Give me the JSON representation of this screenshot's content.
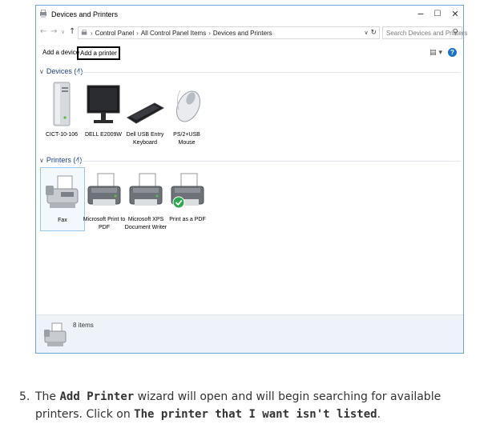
{
  "window": {
    "title": "Devices and Printers",
    "minimize": "−",
    "maximize": "☐",
    "close": "✕"
  },
  "address": {
    "crumbs": [
      "Control Panel",
      "All Control Panel Items",
      "Devices and Printers"
    ],
    "separator": "›",
    "dropdown": "∨",
    "refresh": "↻",
    "search_placeholder": "Search Devices and Printers",
    "search_icon": "search-icon"
  },
  "nav": {
    "back": "←",
    "forward": "→",
    "recent": "∨",
    "up": "↑"
  },
  "commands": {
    "add_device": "Add a device",
    "add_printer": "Add a printer",
    "view": "▤ ▾",
    "help": "?"
  },
  "devices": {
    "header": "Devices (4)",
    "items": [
      {
        "label_lines": [
          "CICT-10-106"
        ],
        "icon": "computer-tower-icon"
      },
      {
        "label_lines": [
          "DELL E2009W"
        ],
        "icon": "monitor-icon"
      },
      {
        "label_lines": [
          "Dell USB Entry",
          "Keyboard"
        ],
        "icon": "keyboard-icon"
      },
      {
        "label_lines": [
          "PS/2+USB Mouse"
        ],
        "icon": "mouse-icon"
      }
    ]
  },
  "printers": {
    "header": "Printers (4)",
    "items": [
      {
        "label_lines": [
          "Fax"
        ],
        "icon": "fax-icon",
        "selected": true
      },
      {
        "label_lines": [
          "Microsoft Print to",
          "PDF"
        ],
        "icon": "printer-icon"
      },
      {
        "label_lines": [
          "Microsoft XPS",
          "Document Writer"
        ],
        "icon": "printer-icon"
      },
      {
        "label_lines": [
          "Print as a PDF"
        ],
        "icon": "default-printer-icon"
      }
    ]
  },
  "status": {
    "text": "8 items",
    "icon": "fax-icon"
  },
  "instruction": {
    "number": "5.",
    "text_1": "The ",
    "bold_1": "Add Printer",
    "text_2": " wizard will open and will begin searching for available printers. Click on ",
    "bold_2": "The printer that I want isn't listed",
    "text_3": "."
  },
  "colors": {
    "window_border": "#6fa4d8",
    "section_header": "#1e3f8f",
    "status_bg": "#eef3fa",
    "help_blue": "#1a73c9",
    "check_green": "#2fa84f"
  }
}
